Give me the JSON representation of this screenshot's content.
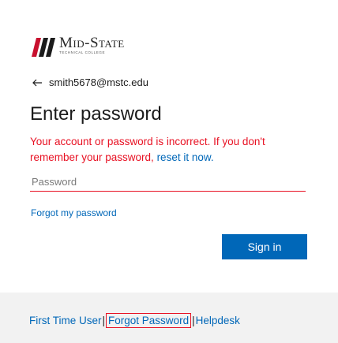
{
  "brand": {
    "title": "Mid-State",
    "subtitle": "Technical College",
    "accent": "#0067b8"
  },
  "identity": {
    "back_icon": "arrow-left-icon",
    "email": "smith5678@mstc.edu"
  },
  "heading": "Enter password",
  "error": {
    "text": "Your account or password is incorrect. If you don't remember your password, ",
    "link": "reset it now.",
    "color": "#e81123"
  },
  "password": {
    "placeholder": "Password",
    "value": ""
  },
  "forgot_link": "Forgot my password",
  "signin_label": "Sign in",
  "footer": {
    "first_time_user": "First Time User",
    "sep1": "|",
    "forgot_password": "Forgot Password",
    "sep2": "|",
    "helpdesk": "Helpdesk"
  }
}
